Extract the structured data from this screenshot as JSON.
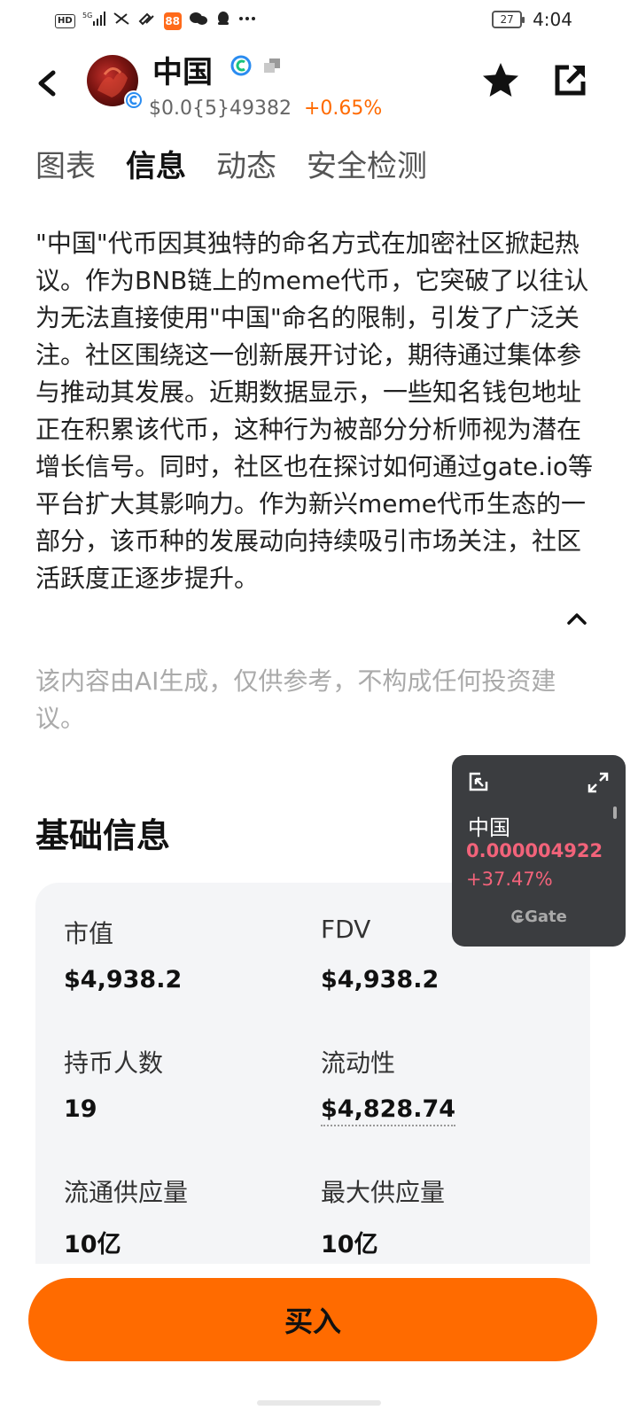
{
  "status_bar": {
    "badge": "HD",
    "network": "5G",
    "app_badge": "88",
    "battery": "27",
    "time": "4:04"
  },
  "header": {
    "token_name": "中国",
    "price": "$0.0{5}49382",
    "change": "+0.65%"
  },
  "tabs": [
    {
      "label": "图表",
      "active": false
    },
    {
      "label": "信息",
      "active": true
    },
    {
      "label": "动态",
      "active": false
    },
    {
      "label": "安全检测",
      "active": false
    }
  ],
  "description": "\"中国\"代币因其独特的命名方式在加密社区掀起热议。作为BNB链上的meme代币，它突破了以往认为无法直接使用\"中国\"命名的限制，引发了广泛关注。社区围绕这一创新展开讨论，期待通过集体参与推动其发展。近期数据显示，一些知名钱包地址正在积累该代币，这种行为被部分分析师视为潜在增长信号。同时，社区也在探讨如何通过gate.io等平台扩大其影响力。作为新兴meme代币生态的一部分，该币种的发展动向持续吸引市场关注，社区活跃度正逐步提升。",
  "disclaimer": "该内容由AI生成，仅供参考，不构成任何投资建议。",
  "basic_info": {
    "title": "基础信息",
    "metrics": [
      {
        "label": "市值",
        "value": "$4,938.2"
      },
      {
        "label": "FDV",
        "value": "$4,938.2"
      },
      {
        "label": "持币人数",
        "value": "19"
      },
      {
        "label": "流动性",
        "value": "$4,828.74"
      },
      {
        "label": "流通供应量",
        "value": "10亿"
      },
      {
        "label": "最大供应量",
        "value": "10亿"
      }
    ]
  },
  "float_widget": {
    "name": "中国",
    "price": "0.000004922",
    "change": "+37.47%",
    "brand": "Gate"
  },
  "buy_label": "买入",
  "colors": {
    "accent": "#ff6b00",
    "negative_pink": "#f2637a",
    "card_bg": "#f4f5f7"
  }
}
